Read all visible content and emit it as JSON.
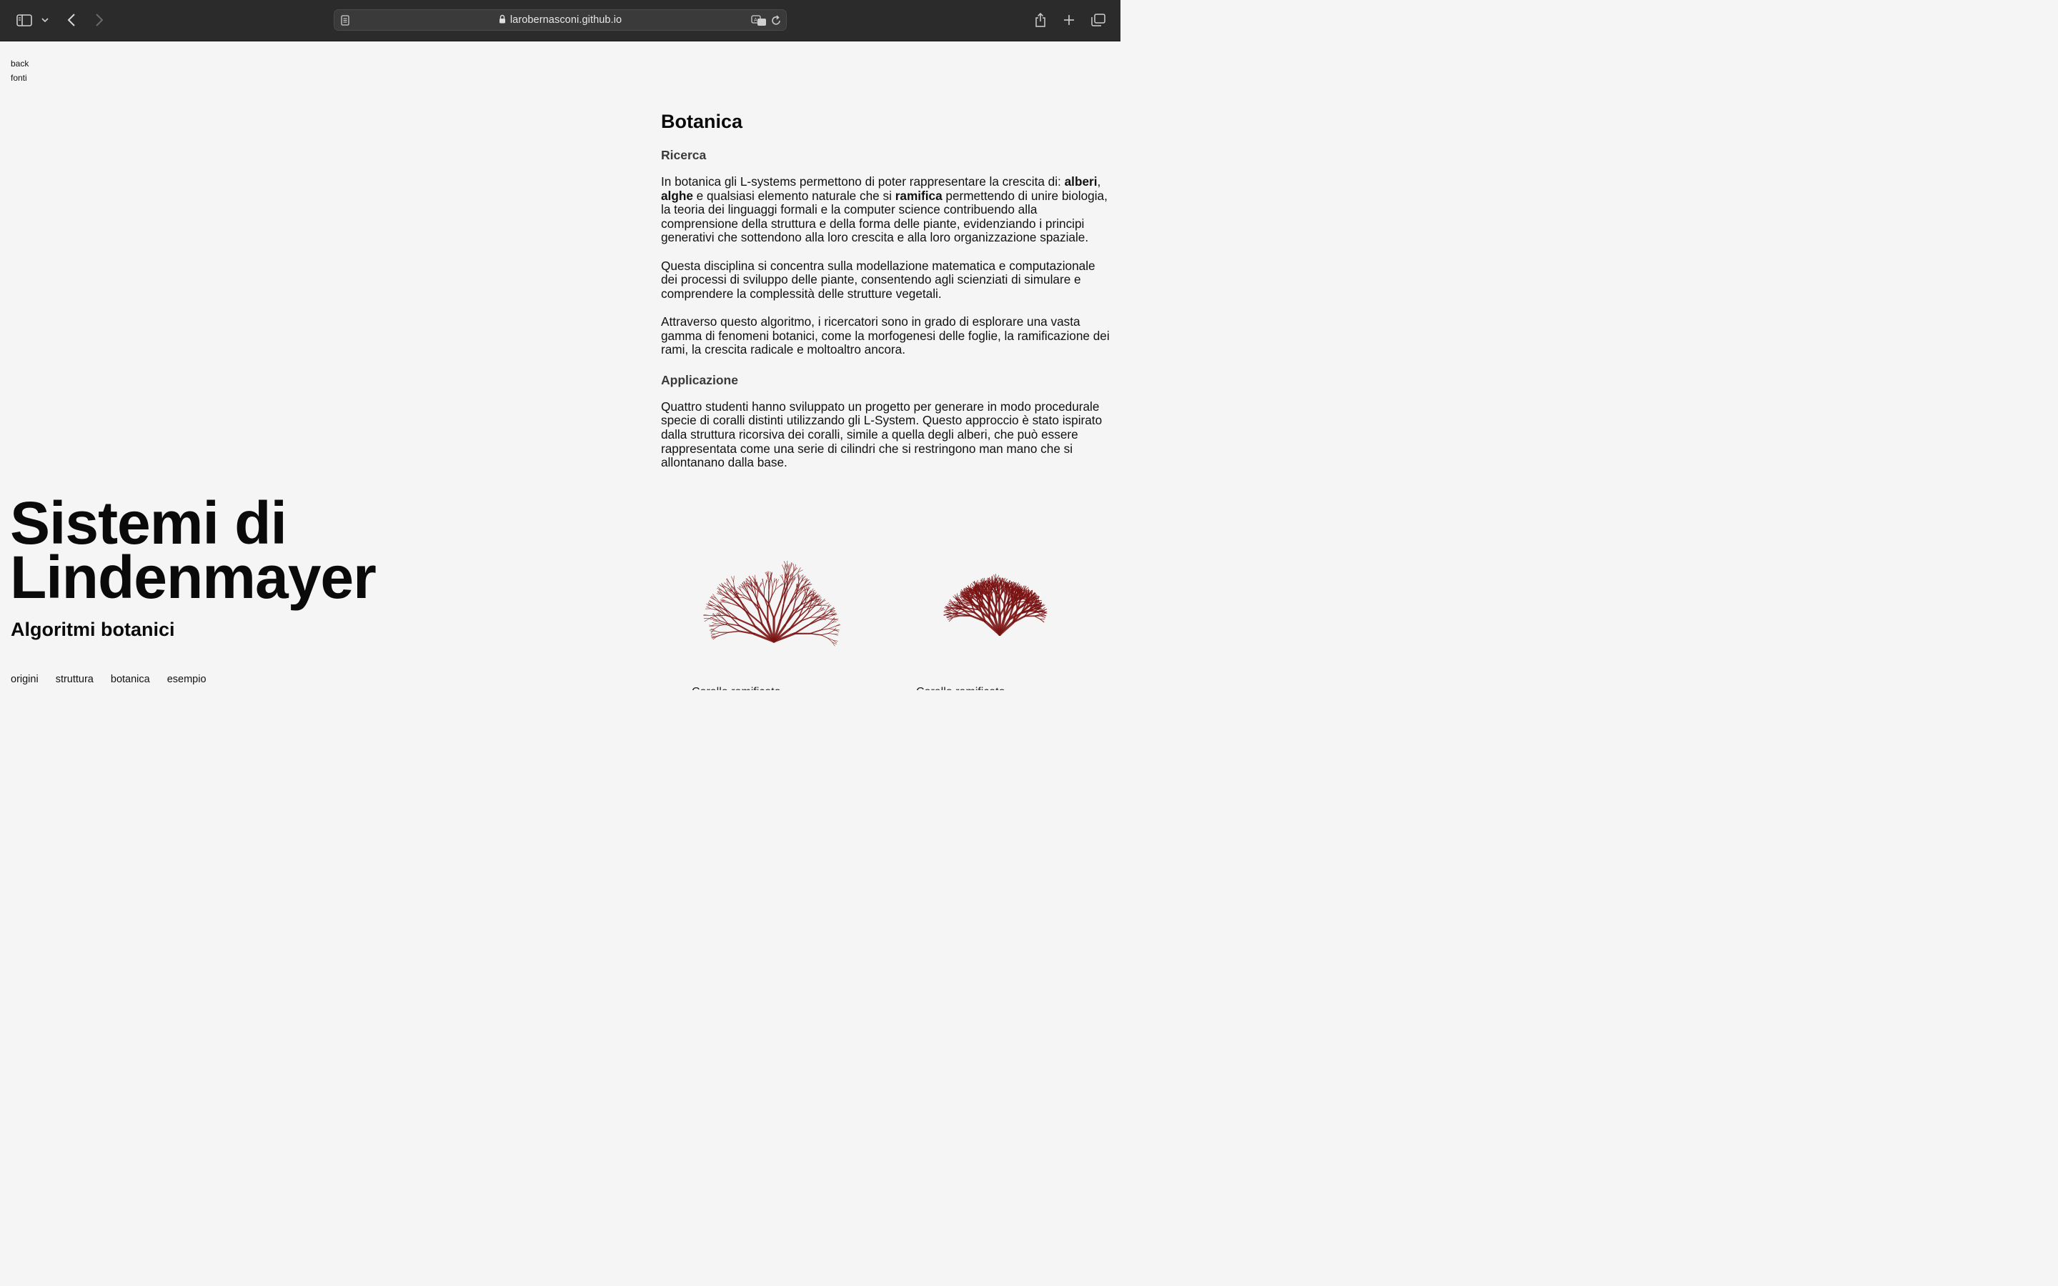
{
  "browser": {
    "url_domain": "larobernasconi.github.io"
  },
  "topnav": {
    "back": "back",
    "fonti": "fonti"
  },
  "hero": {
    "title_line1": "Sistemi di",
    "title_line2": "Lindenmayer",
    "subtitle": "Algoritmi botanici"
  },
  "bottomnav": [
    "origini",
    "struttura",
    "botanica",
    "esempio"
  ],
  "article": {
    "title": "Botanica",
    "section1": "Ricerca",
    "p1_start": "In botanica gli L-systems permettono di poter rappresentare la crescita di: ",
    "p1_b1": "alberi",
    "p1_sep": ", ",
    "p1_b2": "alghe",
    "p1_mid": " e qualsiasi elemento naturale che si ",
    "p1_b3": "ramifica",
    "p1_end": " permettendo di unire biologia, la teoria dei linguaggi formali e la computer science contribuendo alla comprensione della struttura e della forma delle piante, evidenziando i principi generativi che sottendono alla loro crescita e alla loro organizzazione spaziale.",
    "p2": "Questa disciplina si concentra sulla modellazione matematica e computazionale dei processi di sviluppo delle piante, consentendo agli scienziati di simulare e comprendere la complessità delle strutture vegetali.",
    "p3": "Attraverso questo algoritmo, i ricercatori sono in grado di esplorare una vasta gamma di fenomeni botanici, come la morfogenesi delle foglie, la ramificazione dei rami, la crescita radicale e moltoaltro ancora.",
    "section2": "Applicazione",
    "p4": "Quattro studenti hanno sviluppato un progetto per generare in modo procedurale specie di coralli distinti utilizzando gli L-System. Questo approccio è stato ispirato dalla struttura ricorsiva dei coralli, simile a quella degli alberi, che può essere rappresentata come una serie di cilindri che si restringono man mano che si allontanano dalla base."
  },
  "corals": {
    "caption1": "Corallo ramificato",
    "caption2": "Corallo ramificato",
    "color": "#7a1414"
  }
}
